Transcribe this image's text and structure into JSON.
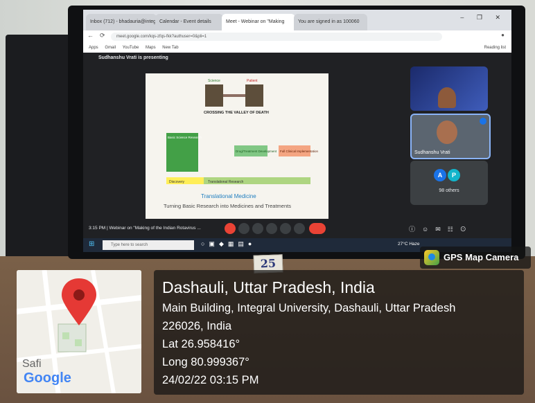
{
  "browser": {
    "tabs": [
      {
        "label": "Inbox (712) - bhadauria@integral...",
        "active": false
      },
      {
        "label": "Calendar - Event details",
        "active": false
      },
      {
        "label": "Meet - Webinar on \"Making",
        "active": true
      },
      {
        "label": "You are signed in as 100060",
        "active": false
      }
    ],
    "url": "meet.google.com/kqs-zfqs-fkk?authuser=0&pli=1",
    "bookmarks": [
      "Apps",
      "Gmail",
      "YouTube",
      "Maps",
      "New Tab"
    ],
    "reading_list": "Reading list"
  },
  "meet": {
    "presenting_label": "Sudhanshu Vrati is presenting",
    "participant_name": "Sudhanshu Vrati",
    "others_count": "98 others",
    "avatar_letters": [
      "A",
      "P"
    ],
    "meeting_bar_text": "3:15 PM | Webinar on \"Making of the Indian Rotavirus ..."
  },
  "slide": {
    "heading": "CROSSING THE VALLEY OF DEATH",
    "left_label": "Science",
    "right_label": "Patient",
    "box_basic": "Basic Science Research",
    "box_preclinical": "Drug/Treatment Development",
    "box_clinical": "Full Clinical Implementation",
    "bar_discovery": "Discovery",
    "bar_translational": "Translational Research",
    "title": "Translational Medicine",
    "subtitle": "Turning Basic Research into Medicines and Treatments"
  },
  "taskbar": {
    "search_placeholder": "Type here to search",
    "weather": "27°C Haze"
  },
  "sticker_number": "25",
  "gps": {
    "brand": "GPS Map Camera",
    "place": "Dashauli, Uttar Pradesh, India",
    "address_line1": "Main Building, Integral University, Dashauli, Uttar Pradesh",
    "address_line2": "226026, India",
    "lat": "Lat 26.958416°",
    "long": "Long 80.999367°",
    "datetime": "24/02/22 03:15 PM",
    "map_label_safi": "Safi",
    "map_label_google": "Google"
  },
  "colors": {
    "pin_red": "#e53935",
    "meet_bg": "#202124",
    "end_call": "#ea4335",
    "slide_title": "#1e7dbf"
  }
}
